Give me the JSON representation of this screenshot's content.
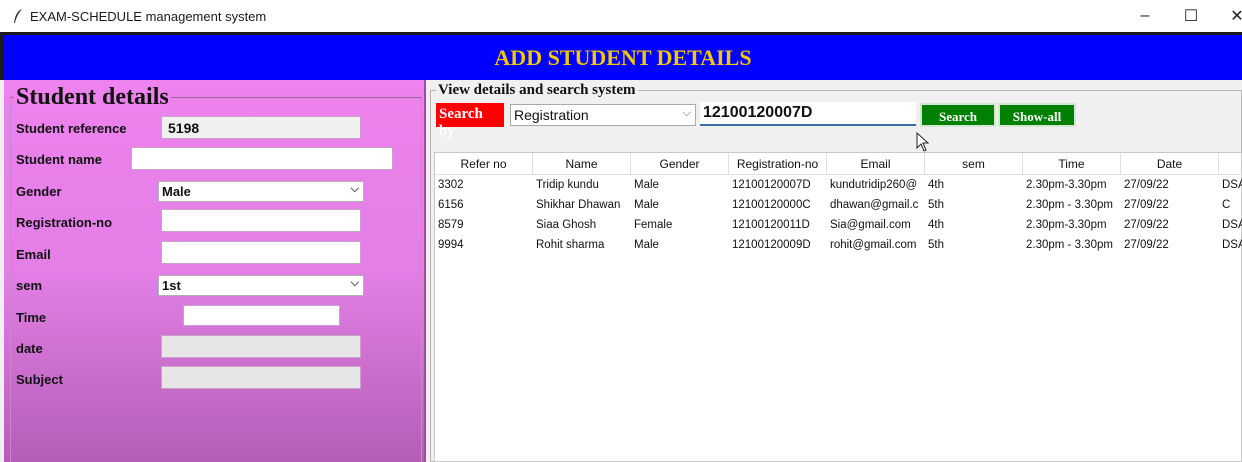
{
  "window": {
    "title": "EXAM-SCHEDULE management system",
    "controls": {
      "minimize": "–",
      "maximize": "☐",
      "close": "✕"
    }
  },
  "header": {
    "title": "ADD STUDENT DETAILS",
    "bg_color": "#0000ff",
    "text_color": "#f4c800"
  },
  "student_form": {
    "legend": "Student details",
    "fields": {
      "reference": {
        "label": "Student reference",
        "value": "5198"
      },
      "name": {
        "label": "Student name",
        "value": ""
      },
      "gender": {
        "label": "Gender",
        "value": "Male"
      },
      "registration": {
        "label": "Registration-no",
        "value": ""
      },
      "email": {
        "label": "Email",
        "value": ""
      },
      "sem": {
        "label": "sem",
        "value": "1st"
      },
      "time": {
        "label": "Time",
        "value": ""
      },
      "date": {
        "label": "date",
        "value": ""
      },
      "subject": {
        "label": "Subject",
        "value": ""
      }
    },
    "bg_color": "#ee82ee"
  },
  "search": {
    "legend": "View details and search system",
    "search_by_label": "Search by",
    "search_by_value": "Registration",
    "query": "12100120007D",
    "search_button": "Search",
    "show_all_button": "Show-all"
  },
  "table": {
    "columns": [
      "Refer no",
      "Name",
      "Gender",
      "Registration-no",
      "Email",
      "sem",
      "Time",
      "Date",
      ""
    ],
    "rows": [
      [
        "3302",
        "Tridip kundu",
        "Male",
        "12100120007D",
        "kundutridip260@",
        "4th",
        "2.30pm-3.30pm",
        "27/09/22",
        "DSA"
      ],
      [
        "6156",
        "Shikhar Dhawan",
        "Male",
        "12100120000C",
        "dhawan@gmail.c",
        "5th",
        "2.30pm - 3.30pm",
        "27/09/22",
        "C"
      ],
      [
        "8579",
        "Siaa Ghosh",
        "Female",
        "12100120011D",
        "Sia@gmail.com",
        "4th",
        "2.30pm-3.30pm",
        "27/09/22",
        "DSA"
      ],
      [
        "9994",
        "Rohit sharma",
        "Male",
        "12100120009D",
        "rohit@gmail.com",
        "5th",
        "2.30pm - 3.30pm",
        "27/09/22",
        "DSA"
      ]
    ]
  }
}
